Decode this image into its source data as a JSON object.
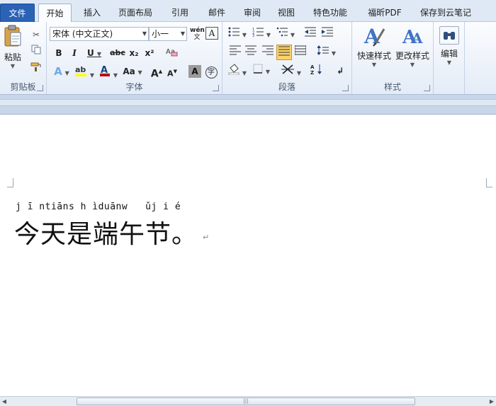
{
  "tabs": {
    "file": "文件",
    "home": "开始",
    "insert": "插入",
    "layout": "页面布局",
    "references": "引用",
    "mailings": "邮件",
    "review": "审阅",
    "view": "视图",
    "special": "特色功能",
    "foxit_pdf": "福昕PDF",
    "save_cloud": "保存到云笔记"
  },
  "clipboard": {
    "label": "剪贴板",
    "paste": "粘贴"
  },
  "font": {
    "label": "字体",
    "font_name": "宋体 (中文正文)",
    "font_size": "小一",
    "bold": "B",
    "italic": "I",
    "underline": "U",
    "strike": "abc",
    "subscript": "x₂",
    "superscript": "x²",
    "pinyin_guide": "wén",
    "char_border": "A",
    "change_case": "Aa",
    "grow": "A",
    "shrink": "A",
    "shading": "A",
    "enclose": "字"
  },
  "paragraph": {
    "label": "段落"
  },
  "styles": {
    "label": "样式",
    "quick_styles": "快速样式",
    "change_styles": "更改样式"
  },
  "editing": {
    "label": "编辑"
  },
  "document": {
    "pinyin": "jīn tiān shì duān wǔ jié",
    "pinyin_display": "j ī ntiāns h ìduānw   ǔj i é",
    "text": "今天是端午节。",
    "para_mark": "↵"
  },
  "colors": {
    "file_tab": "#2a62b6",
    "highlight": "#ffff00",
    "font_color": "#c00000",
    "selected_button": "#fbd36a"
  }
}
